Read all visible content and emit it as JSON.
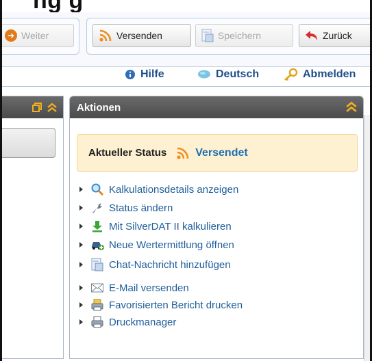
{
  "page": {
    "title": "ng       g"
  },
  "toolbar": {
    "weiter_label": "Weiter",
    "versenden_label": "Versenden",
    "speichern_label": "Speichern",
    "zurueck_label": "Zurück"
  },
  "nav": {
    "hilfe": "Hilfe",
    "deutsch": "Deutsch",
    "abmelden": "Abmelden"
  },
  "actions": {
    "header": "Aktionen",
    "status_label": "Aktueller Status",
    "status_value": "Versendet",
    "items": [
      {
        "label": "Kalkulationsdetails anzeigen",
        "icon": "magnifier-icon"
      },
      {
        "label": "Status ändern",
        "icon": "wrench-icon"
      },
      {
        "label": "Mit SilverDAT II kalkulieren",
        "icon": "download-arrow-icon"
      },
      {
        "label": "Neue Wertermittlung öffnen",
        "icon": "car-plus-icon"
      },
      {
        "label": "Chat-Nachricht hinzufügen",
        "icon": "document-icon"
      },
      {
        "label": "E-Mail versenden",
        "icon": "envelope-icon"
      },
      {
        "label": "Favorisierten Bericht drucken",
        "icon": "printer-star-icon"
      },
      {
        "label": "Druckmanager",
        "icon": "printer-icon"
      }
    ]
  },
  "colors": {
    "link": "#1e5d9a",
    "accent_orange": "#e07b1e",
    "status_bg": "#fdf1d1",
    "header_bg": "#555555"
  }
}
